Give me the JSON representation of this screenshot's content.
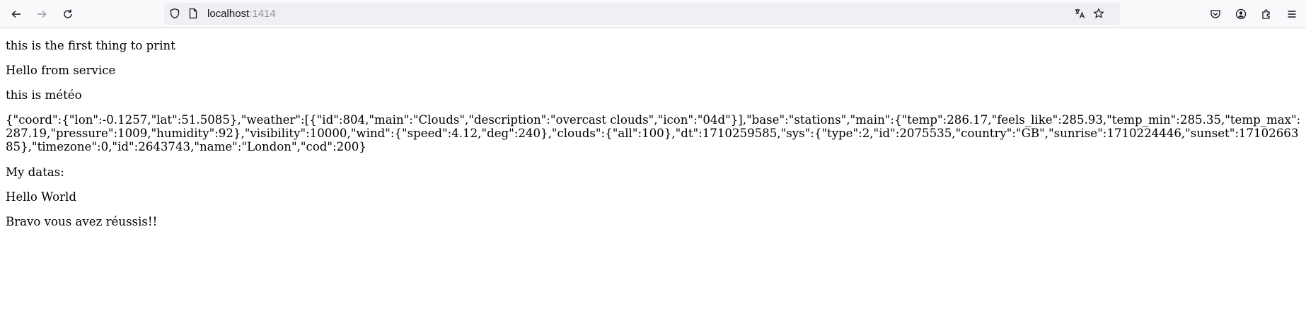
{
  "browser": {
    "url_host": "localhost",
    "url_port": ":1414",
    "icons": [
      "back-arrow-icon",
      "forward-arrow-icon",
      "reload-icon",
      "shield-icon",
      "page-icon",
      "translate-icon",
      "bookmark-star-icon",
      "pocket-icon",
      "account-icon",
      "extensions-icon",
      "menu-icon"
    ]
  },
  "page": {
    "line1": "this is the first thing to print",
    "line2": "Hello from service",
    "line3": "this is météo",
    "json_output": "{\"coord\":{\"lon\":-0.1257,\"lat\":51.5085},\"weather\":[{\"id\":804,\"main\":\"Clouds\",\"description\":\"overcast clouds\",\"icon\":\"04d\"}],\"base\":\"stations\",\"main\":{\"temp\":286.17,\"feels_like\":285.93,\"temp_min\":285.35,\"temp_max\":287.19,\"pressure\":1009,\"humidity\":92},\"visibility\":10000,\"wind\":{\"speed\":4.12,\"deg\":240},\"clouds\":{\"all\":100},\"dt\":1710259585,\"sys\":{\"type\":2,\"id\":2075535,\"country\":\"GB\",\"sunrise\":1710224446,\"sunset\":1710266385},\"timezone\":0,\"id\":2643743,\"name\":\"London\",\"cod\":200}",
    "line5": "My datas:",
    "line6": "Hello World",
    "line7": "Bravo vous avez réussis!!"
  }
}
